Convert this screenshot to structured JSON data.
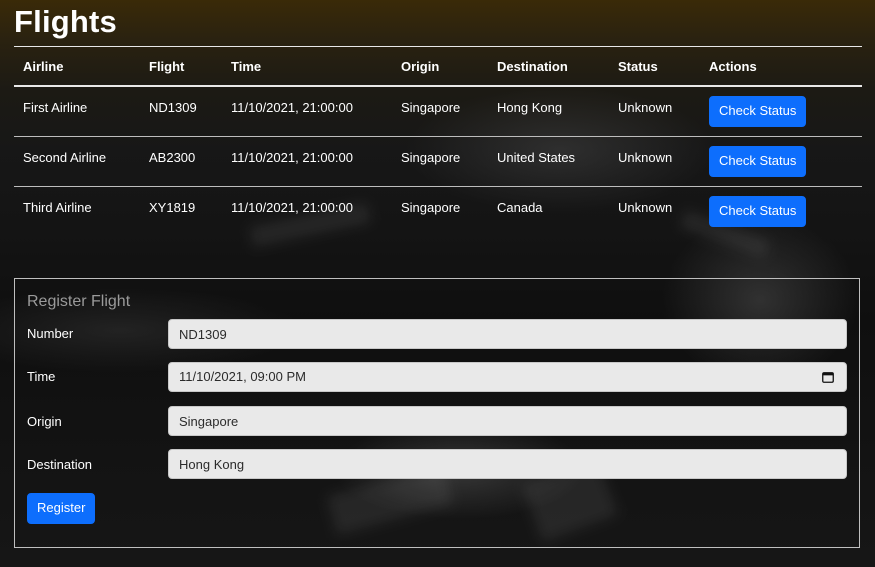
{
  "page": {
    "title": "Flights"
  },
  "table": {
    "headers": [
      "Airline",
      "Flight",
      "Time",
      "Origin",
      "Destination",
      "Status",
      "Actions"
    ],
    "rows": [
      {
        "airline": "First Airline",
        "flight": "ND1309",
        "time": "11/10/2021, 21:00:00",
        "origin": "Singapore",
        "destination": "Hong Kong",
        "status": "Unknown",
        "action_label": "Check Status"
      },
      {
        "airline": "Second Airline",
        "flight": "AB2300",
        "time": "11/10/2021, 21:00:00",
        "origin": "Singapore",
        "destination": "United States",
        "status": "Unknown",
        "action_label": "Check Status"
      },
      {
        "airline": "Third Airline",
        "flight": "XY1819",
        "time": "11/10/2021, 21:00:00",
        "origin": "Singapore",
        "destination": "Canada",
        "status": "Unknown",
        "action_label": "Check Status"
      }
    ]
  },
  "register_form": {
    "title": "Register Flight",
    "fields": {
      "number": {
        "label": "Number",
        "value": "ND1309"
      },
      "time": {
        "label": "Time",
        "value": "11/10/2021, 09:00 PM"
      },
      "origin": {
        "label": "Origin",
        "value": "Singapore"
      },
      "destination": {
        "label": "Destination",
        "value": "Hong Kong"
      }
    },
    "submit_label": "Register"
  },
  "icons": {
    "time_field_icon": "calendar-icon"
  },
  "colors": {
    "primary_button": "#0d6efd",
    "input_background": "#e9e9e9",
    "form_title": "#9a9a9a"
  }
}
